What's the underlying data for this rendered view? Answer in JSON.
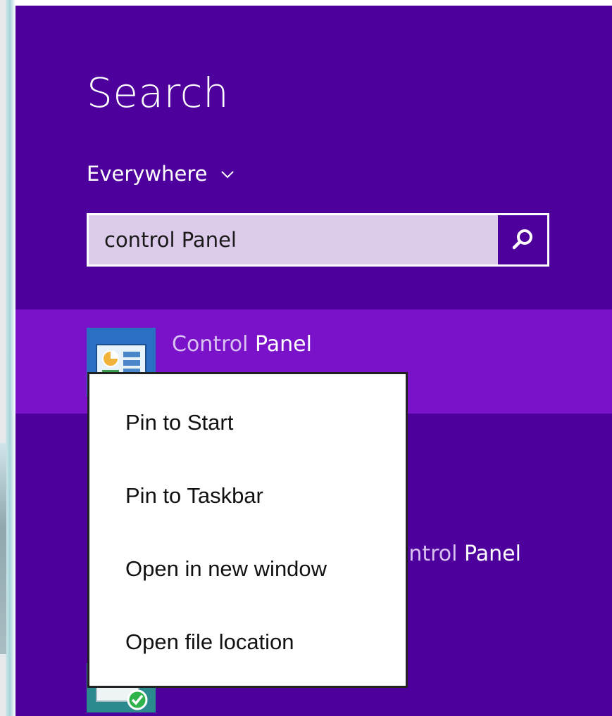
{
  "search_pane": {
    "title": "Search",
    "scope_label": "Everywhere",
    "query": "control Panel"
  },
  "results": [
    {
      "label_dim": "Control ",
      "label_bright": "Panel"
    },
    {
      "label_dim": "ontrol ",
      "label_bright": "Panel"
    }
  ],
  "context_menu": {
    "items": [
      {
        "label": "Pin to Start"
      },
      {
        "label": "Pin to Taskbar"
      },
      {
        "label": "Open in new window"
      },
      {
        "label": "Open file location"
      }
    ]
  },
  "icons": {
    "scope_dropdown": "chevron-down-icon",
    "search_button": "search-icon",
    "result_app": "control-panel-icon",
    "bottom_tile": "security-check-icon"
  },
  "colors": {
    "pane_background": "#4e009c",
    "selected_result": "#7a12c9",
    "search_box_fill": "#dccbea",
    "app_tile": "#2b6fc2"
  }
}
